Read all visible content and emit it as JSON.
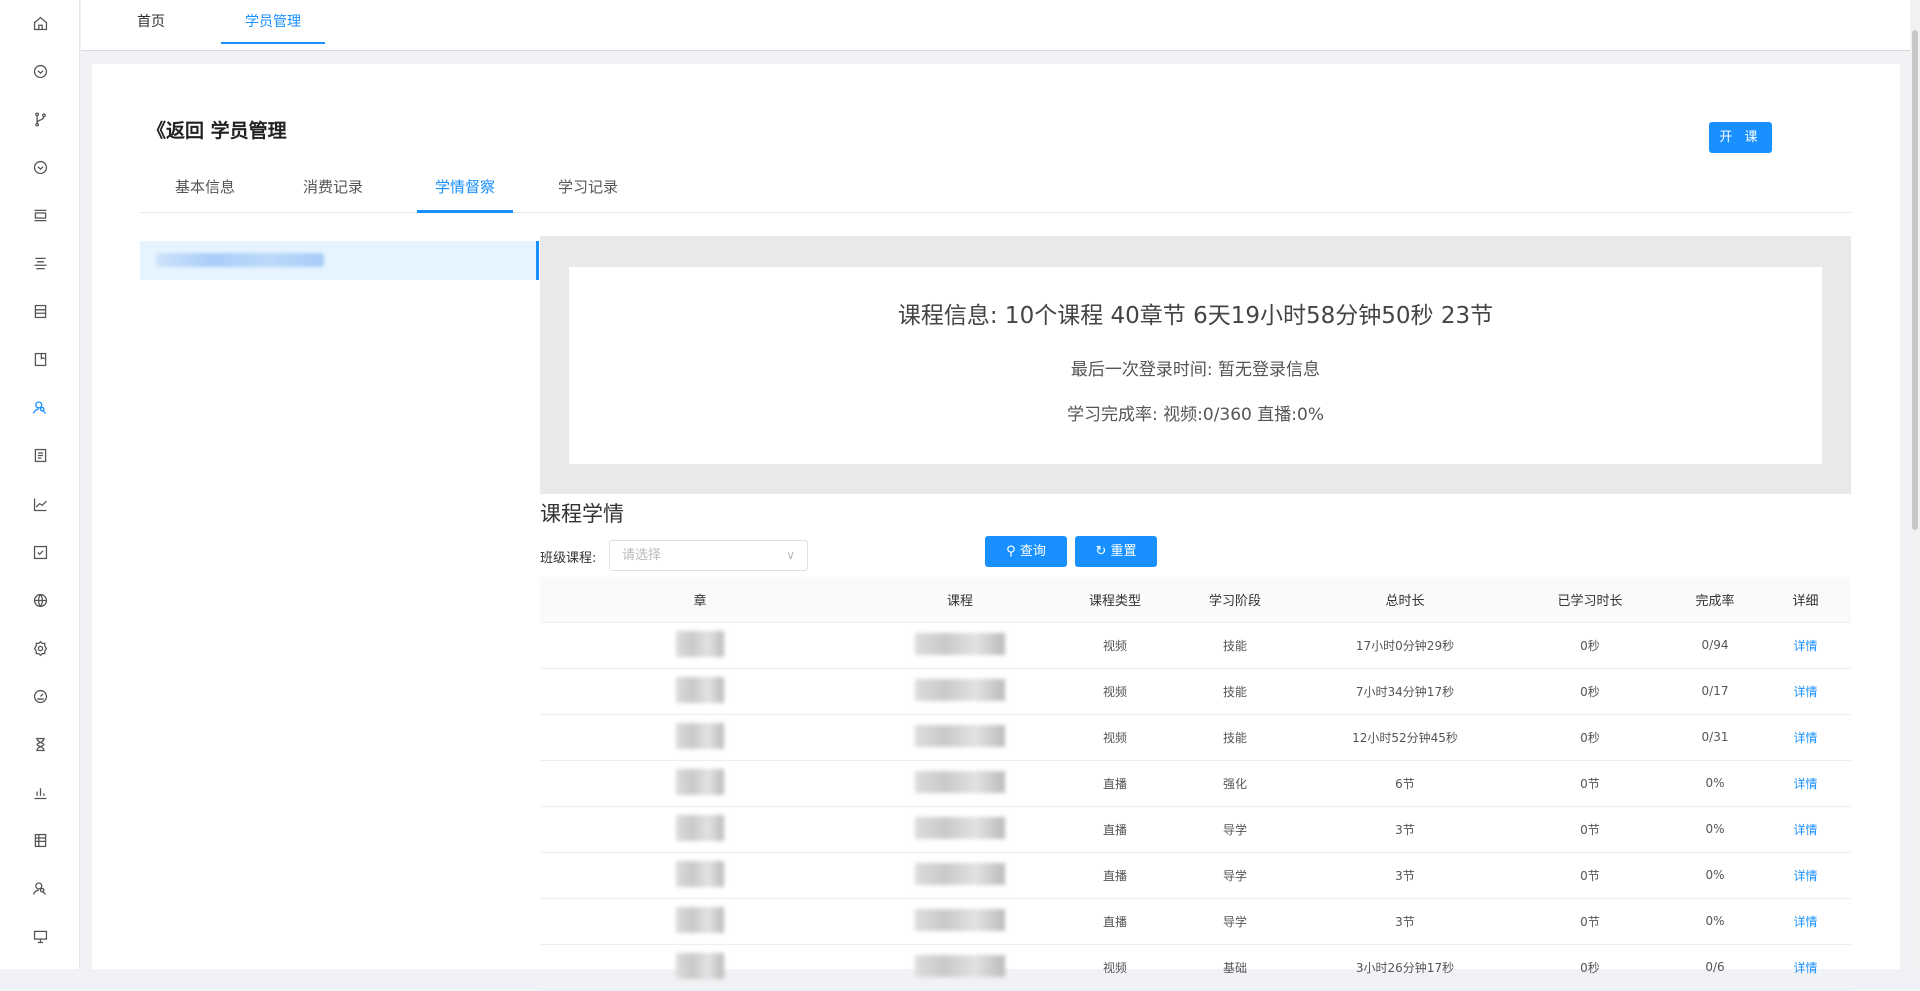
{
  "sidebar": {
    "icons": [
      "home-icon",
      "circle-chevron-icon",
      "branch-icon",
      "circle-chevron-icon",
      "layout-icon",
      "align-center-icon",
      "notebook-icon",
      "book-icon",
      "user-search-icon",
      "document-icon",
      "line-chart-icon",
      "checkbox-icon",
      "globe-icon",
      "gear-icon",
      "dashboard-icon",
      "hourglass-icon",
      "bar-chart-icon",
      "table-icon",
      "user-search-icon",
      "monitor-icon"
    ],
    "active_index": 8
  },
  "top_tabs": [
    {
      "label": "首页"
    },
    {
      "label": "学员管理"
    }
  ],
  "page": {
    "title": "《返回 学员管理",
    "open_course_button": "开 课"
  },
  "tabs": [
    {
      "label": "基本信息"
    },
    {
      "label": "消费记录"
    },
    {
      "label": "学情督察"
    },
    {
      "label": "学习记录"
    }
  ],
  "summary": {
    "course_info": "课程信息: 10个课程 40章节 6天19小时58分钟50秒 23节",
    "last_login": "最后一次登录时间: 暂无登录信息",
    "completion": "学习完成率: 视频:0/360 直播:0%"
  },
  "section_title": "课程学情",
  "filter": {
    "label": "班级课程:",
    "placeholder": "请选择",
    "search_button": "查询",
    "reset_button": "重置"
  },
  "table": {
    "headers": [
      "章",
      "课程",
      "课程类型",
      "学习阶段",
      "总时长",
      "已学习时长",
      "完成率",
      "详细"
    ],
    "rows": [
      {
        "type": "视频",
        "stage": "技能",
        "total": "17小时0分钟29秒",
        "learned": "0秒",
        "rate": "0/94",
        "detail": "详情"
      },
      {
        "type": "视频",
        "stage": "技能",
        "total": "7小时34分钟17秒",
        "learned": "0秒",
        "rate": "0/17",
        "detail": "详情"
      },
      {
        "type": "视频",
        "stage": "技能",
        "total": "12小时52分钟45秒",
        "learned": "0秒",
        "rate": "0/31",
        "detail": "详情"
      },
      {
        "type": "直播",
        "stage": "强化",
        "total": "6节",
        "learned": "0节",
        "rate": "0%",
        "detail": "详情"
      },
      {
        "type": "直播",
        "stage": "导学",
        "total": "3节",
        "learned": "0节",
        "rate": "0%",
        "detail": "详情"
      },
      {
        "type": "直播",
        "stage": "导学",
        "total": "3节",
        "learned": "0节",
        "rate": "0%",
        "detail": "详情"
      },
      {
        "type": "直播",
        "stage": "导学",
        "total": "3节",
        "learned": "0节",
        "rate": "0%",
        "detail": "详情"
      },
      {
        "type": "视频",
        "stage": "基础",
        "total": "3小时26分钟17秒",
        "learned": "0秒",
        "rate": "0/6",
        "detail": "详情"
      }
    ]
  },
  "colors": {
    "accent": "#1890ff"
  }
}
